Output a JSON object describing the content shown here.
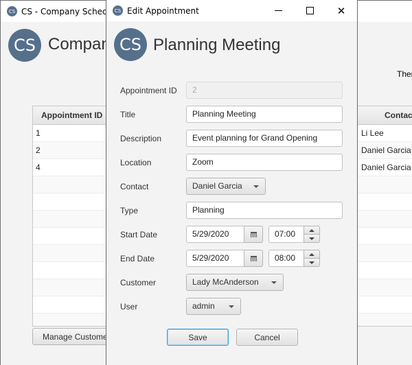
{
  "main_window": {
    "title": "CS - Company Schedule",
    "logo_text": "CS",
    "heading": "Company",
    "right_text": "Ther",
    "table": {
      "columns": [
        "Appointment ID",
        "Contact"
      ],
      "rows": [
        {
          "id": "1",
          "contact": "Li Lee"
        },
        {
          "id": "2",
          "contact": "Daniel Garcia"
        },
        {
          "id": "4",
          "contact": "Daniel Garcia"
        },
        {
          "id": "",
          "contact": ""
        },
        {
          "id": "",
          "contact": ""
        },
        {
          "id": "",
          "contact": ""
        },
        {
          "id": "",
          "contact": ""
        },
        {
          "id": "",
          "contact": ""
        },
        {
          "id": "",
          "contact": ""
        },
        {
          "id": "",
          "contact": ""
        },
        {
          "id": "",
          "contact": ""
        },
        {
          "id": "",
          "contact": ""
        }
      ]
    },
    "manage_customers_label": "Manage Customers"
  },
  "dialog": {
    "title": "Edit Appointment",
    "icon_text": "CS",
    "logo_text": "CS",
    "heading": "Planning Meeting",
    "window_controls": {
      "minimize": "—",
      "maximize": "☐",
      "close": "✕"
    },
    "labels": {
      "appointment_id": "Appointment ID",
      "title": "Title",
      "description": "Description",
      "location": "Location",
      "contact": "Contact",
      "type": "Type",
      "start_date": "Start Date",
      "end_date": "End Date",
      "customer": "Customer",
      "user": "User"
    },
    "values": {
      "appointment_id": "2",
      "title": "Planning Meeting",
      "description": "Event planning for Grand Opening",
      "location": "Zoom",
      "contact": "Daniel Garcia",
      "type": "Planning",
      "start_date": "5/29/2020",
      "start_time": "07:00",
      "end_date": "5/29/2020",
      "end_time": "08:00",
      "customer": "Lady McAnderson",
      "user": "admin"
    },
    "buttons": {
      "save": "Save",
      "cancel": "Cancel"
    }
  },
  "colors": {
    "logo_bg": "#56708c",
    "focus_border": "#39a3d9"
  }
}
